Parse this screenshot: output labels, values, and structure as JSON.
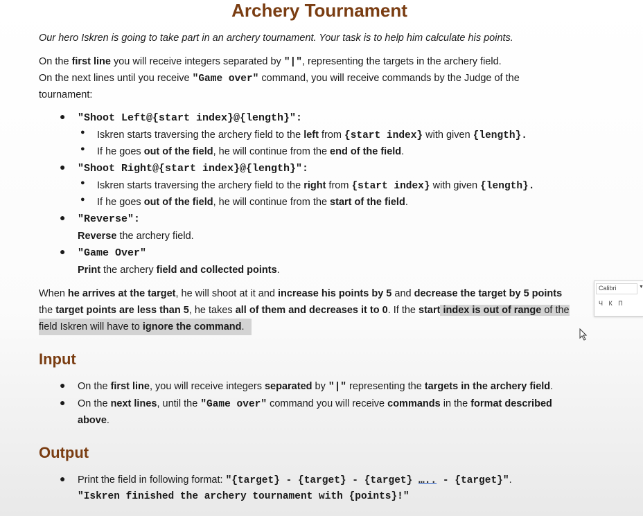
{
  "title": "Archery Tournament",
  "intro": "Our hero Iskren is going to take part in an archery tournament. Your task is to help him calculate his points.",
  "line1": {
    "a": "On the ",
    "b": "first line",
    "c": " you will receive integers separated by ",
    "d": "\"|\"",
    "e": ", representing the targets in the archery field."
  },
  "line2": {
    "a": "On the next lines until you receive ",
    "b": "\"Game over\"",
    "c": " command, you will receive commands by the Judge of the"
  },
  "line3": "tournament:",
  "cmd_left": {
    "head": "\"Shoot Left@{start index}@{length}\":",
    "s1": {
      "a": "Iskren starts traversing the archery field to the ",
      "b": "left",
      "c": " from ",
      "d": "{start index}",
      "e": " with given ",
      "f": "{length}",
      "g": "."
    },
    "s2": {
      "a": "If he goes ",
      "b": "out of the field",
      "c": ", he will continue from the ",
      "d": "end of the field",
      "e": "."
    }
  },
  "cmd_right": {
    "head": "\"Shoot Right@{start index}@{length}\":",
    "s1": {
      "a": "Iskren starts traversing the archery field to the ",
      "b": "right",
      "c": " from ",
      "d": "{start index}",
      "e": " with given ",
      "f": "{length}",
      "g": "."
    },
    "s2": {
      "a": "If he goes ",
      "b": "out of the field",
      "c": ", he will continue from the ",
      "d": "start of the field",
      "e": "."
    }
  },
  "cmd_reverse": {
    "head": "\"Reverse\":",
    "b": "Reverse",
    "c": " the archery field."
  },
  "cmd_gameover": {
    "head": "\"Game Over\"",
    "b": "Print",
    "c": " the archery ",
    "d": "field and collected points",
    "e": "."
  },
  "para": {
    "l1a": "When ",
    "l1b": "he arrives at the target",
    "l1c": ", he will shoot at it and ",
    "l1d": "increase his points by 5",
    "l1e": " and ",
    "l1f": "decrease the target by 5 points",
    "l2a": "the ",
    "l2b": "target points are less than 5",
    "l2c": ", he takes ",
    "l2d": "all of them and decreases it to 0",
    "l2e": ". If the ",
    "l2f": "start",
    "l2g": " index is out of range",
    "l2h": " of the",
    "l3a": "field Iskren will have to ",
    "l3b": "ignore the command",
    "l3c": "."
  },
  "input_heading": "Input",
  "input1": {
    "a": "On the ",
    "b": "first line",
    "c": ", you will receive integers ",
    "d": "separated",
    "e": " by ",
    "f": "\"|\"",
    "g": " representing the ",
    "h": "targets in the archery field",
    "i": "."
  },
  "input2": {
    "a": "On the ",
    "b": "next lines",
    "c": ", until the ",
    "d": "\"Game over\"",
    "e": " command you will receive ",
    "f": "commands",
    "g": " in the ",
    "h": "format described",
    "i": "above",
    "j": "."
  },
  "output_heading": "Output",
  "output1": {
    "a": "Print the field in following format: ",
    "b": "\"{target} - {target} - {target} ",
    "c": "…..",
    "d": " - {target}\"",
    "e": "."
  },
  "output2": "\"Iskren finished the archery tournament with {points}!\"",
  "mini_toolbar": {
    "font": "Calibri",
    "buttons": "Ч К П"
  }
}
